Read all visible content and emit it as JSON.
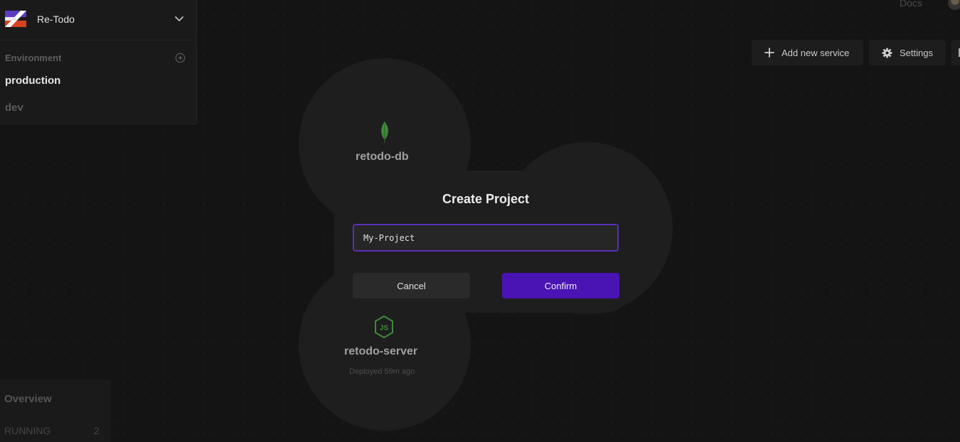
{
  "project": {
    "name": "Re-Todo"
  },
  "environment": {
    "label": "Environment",
    "items": [
      {
        "label": "production",
        "active": true
      },
      {
        "label": "dev",
        "active": false
      }
    ]
  },
  "header": {
    "docs_label": "Docs",
    "add_service_label": "Add new service",
    "settings_label": "Settings"
  },
  "services": [
    {
      "name": "retodo-db",
      "icon": "mongodb-leaf-icon"
    },
    {
      "name": "retodo-server",
      "icon": "nodejs-icon",
      "status": "Deployed 59m ago"
    }
  ],
  "modal": {
    "title": "Create Project",
    "input_value": "My-Project",
    "cancel_label": "Cancel",
    "confirm_label": "Confirm"
  },
  "overview": {
    "title": "Overview",
    "running_label": "RUNNING",
    "running_count": "2"
  },
  "colors": {
    "accent": "#4a14b4",
    "input_border": "#5a2fb7",
    "background": "#141414",
    "panel": "#1a1a1a",
    "mongodb_green": "#3f8a3a",
    "nodejs_green": "#3f8a3a"
  }
}
